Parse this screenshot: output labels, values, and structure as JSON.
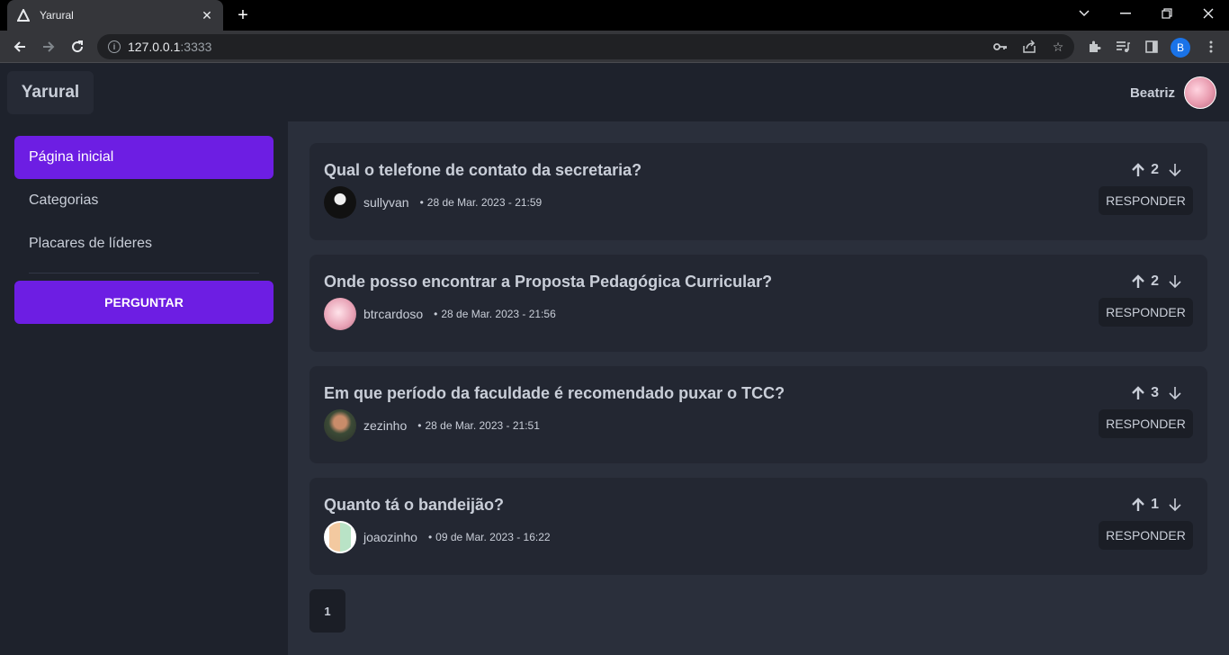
{
  "browser": {
    "tab_title": "Yarural",
    "url_host": "127.0.0.1",
    "url_port": ":3333",
    "profile_initial": "B"
  },
  "header": {
    "brand": "Yarural",
    "user_name": "Beatriz"
  },
  "sidebar": {
    "items": [
      {
        "label": "Página inicial",
        "active": true
      },
      {
        "label": "Categorias",
        "active": false
      },
      {
        "label": "Placares de líderes",
        "active": false
      }
    ],
    "ask_label": "PERGUNTAR"
  },
  "questions": [
    {
      "title": "Qual o telefone de contato da secretaria?",
      "author": "sullyvan",
      "date": "28 de Mar. 2023 - 21:59",
      "votes": "2"
    },
    {
      "title": "Onde posso encontrar a Proposta Pedagógica Curricular?",
      "author": "btrcardoso",
      "date": "28 de Mar. 2023 - 21:56",
      "votes": "2"
    },
    {
      "title": "Em que período da faculdade é recomendado puxar o TCC?",
      "author": "zezinho",
      "date": "28 de Mar. 2023 - 21:51",
      "votes": "3"
    },
    {
      "title": "Quanto tá o bandeijão?",
      "author": "joaozinho",
      "date": "09 de Mar. 2023 - 16:22",
      "votes": "1"
    }
  ],
  "reply_label": "RESPONDER",
  "meta_separator": "•",
  "pagination": {
    "current": "1"
  },
  "colors": {
    "accent": "#6d1ee3",
    "background": "#2a2f3b",
    "card": "#232732"
  }
}
